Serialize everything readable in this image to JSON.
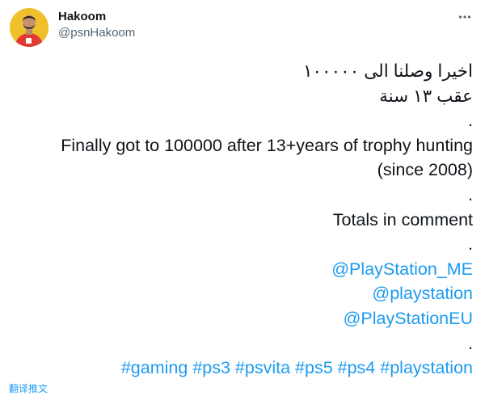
{
  "author": {
    "display_name": "Hakoom",
    "handle": "@psnHakoom"
  },
  "tweet": {
    "arabic_line_1": "اخيرا وصلنا الى ١٠٠٠٠٠",
    "arabic_line_2": "عقب ١٣ سنة",
    "dot_1": ".",
    "english_line_1": "Finally got to 100000 after 13+years of trophy hunting",
    "english_line_2": "(since 2008)",
    "dot_2": ".",
    "totals_line": "Totals in comment",
    "dot_3": ".",
    "mentions": [
      "@PlayStation_ME",
      "@playstation",
      "@PlayStationEU"
    ],
    "dot_4": ".",
    "hashtags": [
      "#gaming",
      "#ps3",
      "#psvita",
      "#ps5",
      "#ps4",
      "#playstation"
    ]
  },
  "translate_label": "翻译推文",
  "icons": {
    "more": "more-options-icon"
  },
  "colors": {
    "link": "#1d9bf0",
    "text": "#0f1419",
    "secondary": "#536471"
  }
}
